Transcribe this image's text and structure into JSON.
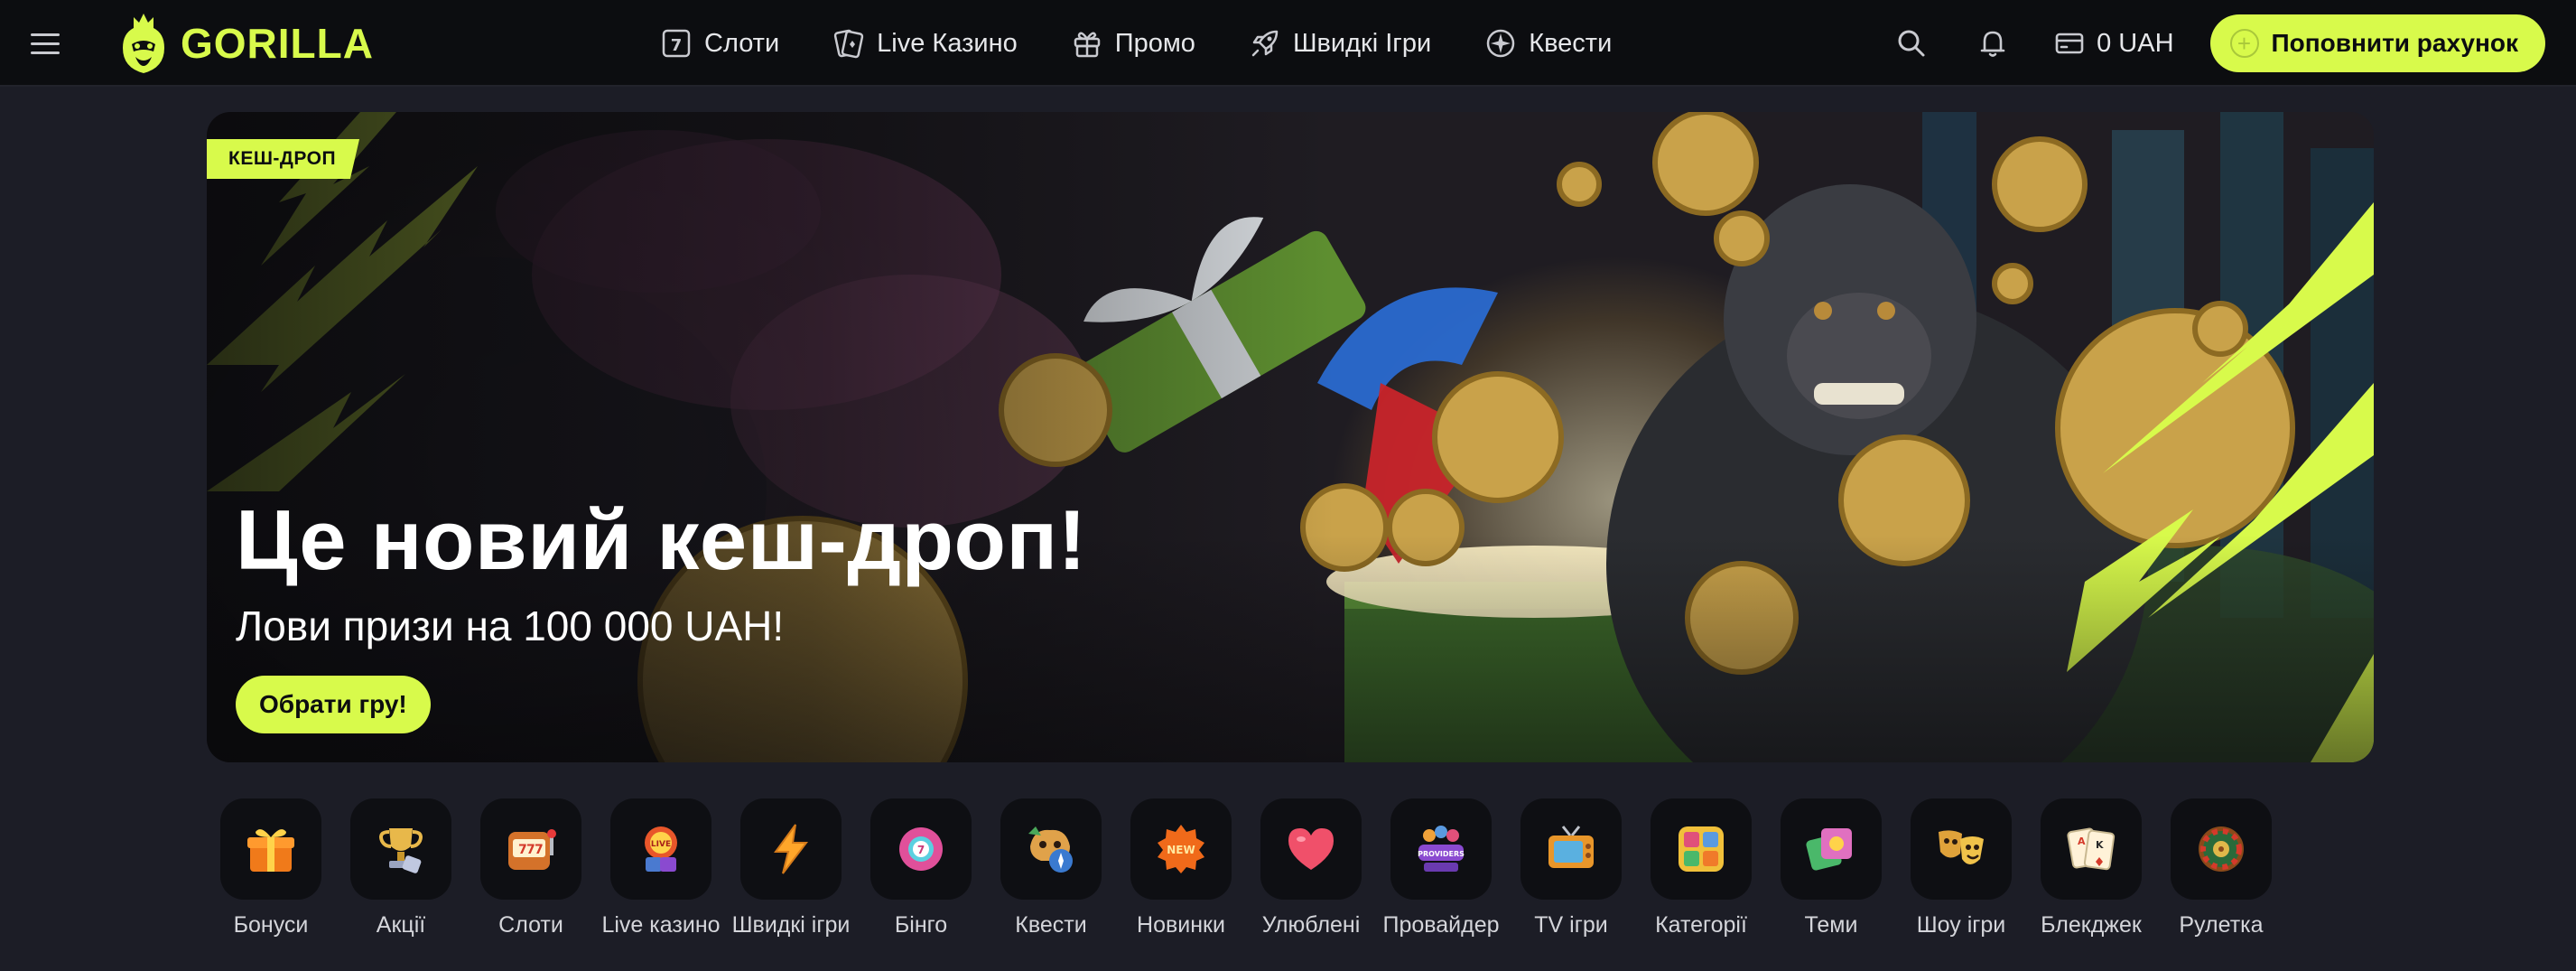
{
  "header": {
    "brand": "GORILLA",
    "nav": [
      {
        "label": "Слоти",
        "icon": "slot-icon"
      },
      {
        "label": "Live Казино",
        "icon": "cards-icon"
      },
      {
        "label": "Промо",
        "icon": "gift-icon"
      },
      {
        "label": "Швидкі Ігри",
        "icon": "rocket-icon"
      },
      {
        "label": "Квести",
        "icon": "compass-icon"
      }
    ],
    "balance": "0 UAH",
    "deposit_label": "Поповнити рахунок"
  },
  "banner": {
    "tag": "КЕШ-ДРОП",
    "title": "Це новий кеш-дроп!",
    "subtitle": "Лови призи на 100 000 UAH!",
    "cta_label": "Обрати гру!"
  },
  "categories": [
    {
      "label": "Бонуси",
      "icon": "gift-box-icon"
    },
    {
      "label": "Акції",
      "icon": "trophy-icon"
    },
    {
      "label": "Слоти",
      "icon": "slot-machine-icon"
    },
    {
      "label": "Live казино",
      "icon": "live-casino-icon"
    },
    {
      "label": "Швидкі ігри",
      "icon": "lightning-icon"
    },
    {
      "label": "Бінго",
      "icon": "bingo-ball-icon"
    },
    {
      "label": "Квести",
      "icon": "quest-compass-icon"
    },
    {
      "label": "Новинки",
      "icon": "new-badge-icon"
    },
    {
      "label": "Улюблені",
      "icon": "heart-icon"
    },
    {
      "label": "Провайдер",
      "icon": "providers-icon"
    },
    {
      "label": "TV ігри",
      "icon": "tv-icon"
    },
    {
      "label": "Категорії",
      "icon": "categories-icon"
    },
    {
      "label": "Теми",
      "icon": "themes-icon"
    },
    {
      "label": "Шоу ігри",
      "icon": "masks-icon"
    },
    {
      "label": "Блекджек",
      "icon": "playing-cards-icon"
    },
    {
      "label": "Рулетка",
      "icon": "roulette-icon"
    }
  ],
  "colors": {
    "accent": "#d8fa4b",
    "background": "#1c1d26",
    "topbar": "#0c0d10"
  }
}
